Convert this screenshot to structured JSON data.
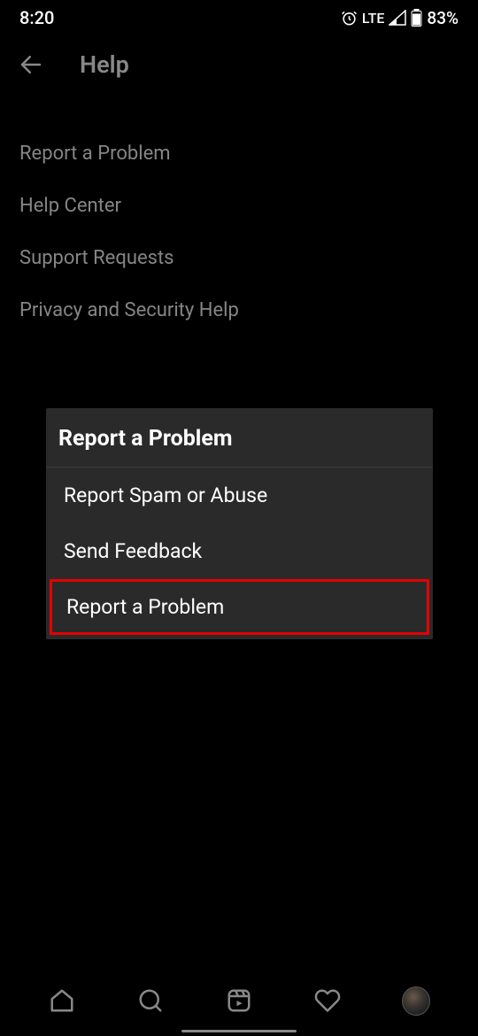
{
  "status": {
    "time": "8:20",
    "network": "LTE",
    "battery": "83%"
  },
  "header": {
    "title": "Help"
  },
  "menu": {
    "items": [
      {
        "label": "Report a Problem"
      },
      {
        "label": "Help Center"
      },
      {
        "label": "Support Requests"
      },
      {
        "label": "Privacy and Security Help"
      }
    ]
  },
  "dialog": {
    "title": "Report a Problem",
    "items": [
      {
        "label": "Report Spam or Abuse"
      },
      {
        "label": "Send Feedback"
      },
      {
        "label": "Report a Problem",
        "highlighted": true
      }
    ]
  },
  "bottomnav": {
    "items": [
      "home",
      "search",
      "reels",
      "activity",
      "profile"
    ]
  }
}
